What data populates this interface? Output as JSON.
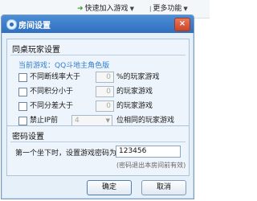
{
  "toolbar": {
    "quick_join": "快速加入游戏",
    "more": "更多功能"
  },
  "dialog": {
    "title": "房间设置",
    "close_glyph": "×",
    "group1": {
      "title": "同桌玩家设置",
      "current_mode": "当前游戏：QQ斗地主角色版",
      "rows": [
        {
          "label": "不同断线率大于",
          "value": "0",
          "suffix": "%的玩家游戏"
        },
        {
          "label": "不同积分小于",
          "value": "0",
          "suffix": "的玩家游戏"
        },
        {
          "label": "不同分差大于",
          "value": "0",
          "suffix": "的玩家游戏"
        },
        {
          "label": "禁止IP前",
          "value": "4",
          "suffix": "位相同的玩家游戏"
        }
      ]
    },
    "group2": {
      "title": "密码设置",
      "prompt": "第一个坐下时，设置游戏密码为：",
      "password": "123456",
      "note": "(密码退出本房间前有效)"
    },
    "ok_label": "确定",
    "cancel_label": "取消"
  }
}
